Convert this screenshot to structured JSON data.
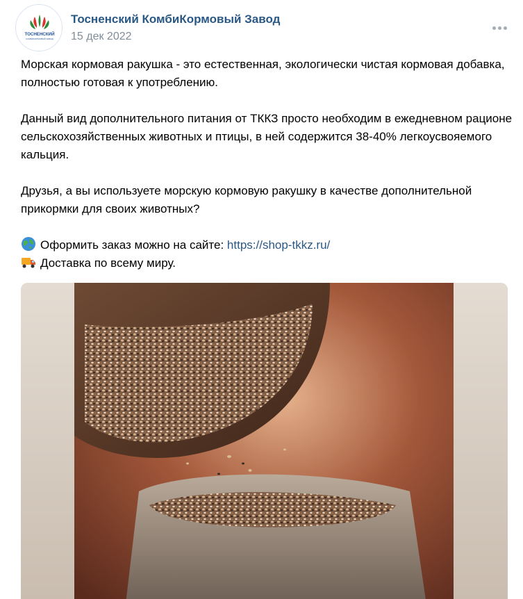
{
  "post": {
    "author": "Тосненский КомбиКормовый Завод",
    "date": "15 дек 2022",
    "avatar_text": "ТОСНЕНСКИЙ",
    "avatar_subtext": "КОМБИКОРМОВЫЙ ЗАВОД",
    "paragraphs": [
      "Морская кормовая ракушка - это естественная, экологически чистая кормовая добавка, полностью готовая к употреблению.",
      "Данный вид дополнительного питания от ТККЗ просто необходим в ежедневном рационе сельскохозяйственных животных и птицы, в ней содержится 38-40% легкоусвояемого кальция.",
      "Друзья, а вы используете морскую кормовую ракушку в качестве дополнительной прикормки для своих животных?"
    ],
    "order_text": "Оформить заказ можно на сайте: ",
    "order_link": "https://shop-tkkz.ru/",
    "delivery_text": "Доставка по всему миру."
  },
  "icons": {
    "more": "more-horizontal-icon",
    "globe": "globe-emoji-icon",
    "truck": "delivery-truck-emoji-icon"
  },
  "colors": {
    "link": "#2a5885",
    "date": "#818c99",
    "brand_green": "#2e8b3a",
    "brand_red": "#d9332b",
    "brand_blue": "#1f4f9c"
  }
}
